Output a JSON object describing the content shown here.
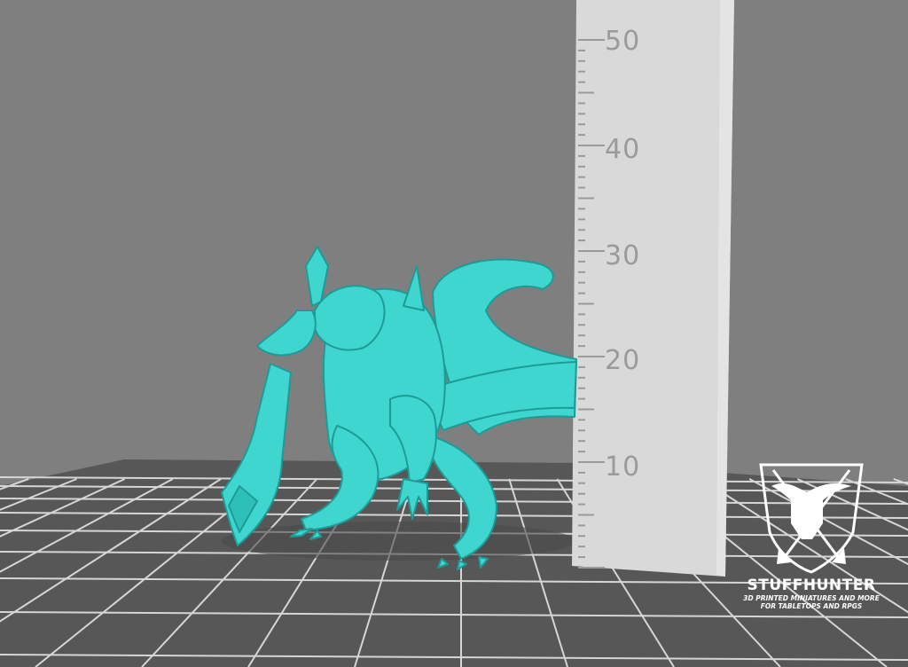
{
  "scene": {
    "background_color": "#7f7f7f",
    "floor_color": "#575757",
    "grid_line_color": "#d6d6d6",
    "model_color": "#3fd6d0",
    "ruler_color": "#d9d9d9"
  },
  "ruler": {
    "labels": [
      "50",
      "40",
      "30",
      "20",
      "10"
    ]
  },
  "watermark": {
    "name": "STUFFHUNTER",
    "tagline_line1": "3D PRINTED MINIATURES AND MORE",
    "tagline_line2": "FOR TABLETOPS AND RPGS",
    "logo_icon": "bull-skull-shield-icon"
  }
}
